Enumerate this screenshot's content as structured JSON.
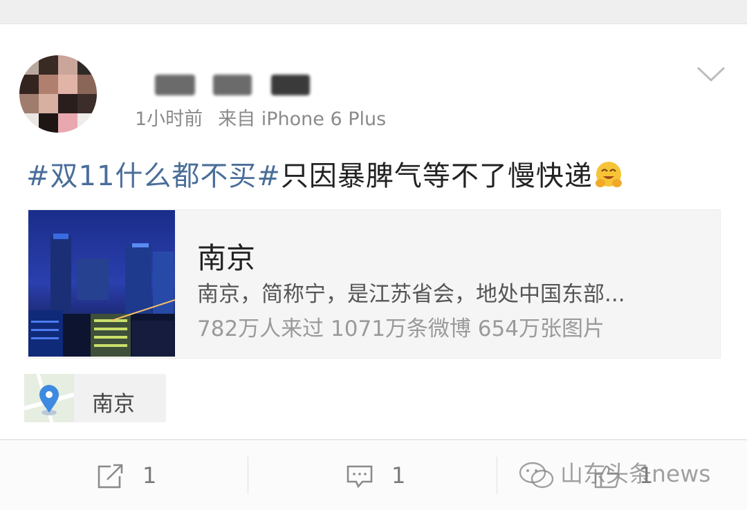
{
  "post": {
    "username": "",
    "time": "1小时前",
    "source": "来自 iPhone 6 Plus",
    "hashtag": "#双11什么都不买#",
    "text": "只因暴脾气等不了慢快递",
    "emoji": "hug-emoji"
  },
  "location_card": {
    "title": "南京",
    "description": "南京，简称宁，是江苏省会，地处中国东部...",
    "stats": "782万人来过 1071万条微博 654万张图片"
  },
  "location_tag": {
    "label": "南京"
  },
  "actions": {
    "repost_count": "1",
    "comment_count": "1",
    "like_count": "1"
  },
  "watermark": {
    "text": "山东头条news"
  },
  "colors": {
    "hashtag": "#4a6e99",
    "location_pin": "#3d8ae0"
  }
}
